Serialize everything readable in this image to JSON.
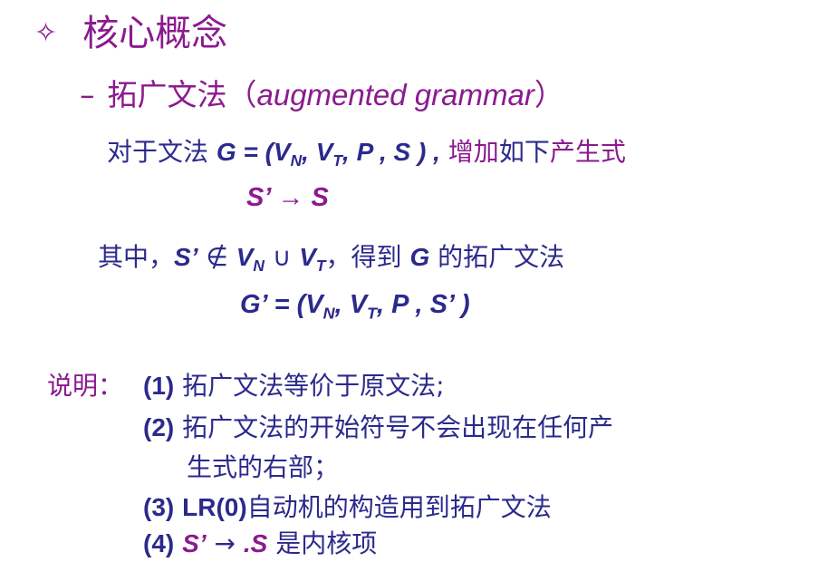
{
  "title": {
    "bullet": "✧",
    "text": "核心概念"
  },
  "subtitle": {
    "dash": "–",
    "zh": "拓广文法（",
    "en": "augmented grammar",
    "close": "）"
  },
  "intro": {
    "prefix": "对于文法",
    "g_def": "G = (V",
    "sub_n": "N",
    "comma1": ", V",
    "sub_t": "T",
    "rest": ", P , S ) ,",
    "highlight1": "增加",
    "mid": "如下",
    "highlight2": "产生式"
  },
  "production": {
    "text": "S’ → S"
  },
  "condition": {
    "prefix": "其中，",
    "s_prime": "S’",
    "notin": "∉",
    "v": "V",
    "sub_n": "N",
    "union": "∪",
    "v2": "V",
    "sub_t": "T",
    "suffix_a": "，得到 ",
    "g": "G",
    "suffix_b": " 的拓广文法"
  },
  "g_prime": {
    "head": "G’ = (V",
    "sub_n": "N",
    "comma": ", V",
    "sub_t": "T",
    "tail": ", P , S’ )"
  },
  "notes": {
    "label": "说明：",
    "items": [
      {
        "num": "(1)",
        "text": "拓广文法等价于原文法;"
      },
      {
        "num": "(2)",
        "text": "拓广文法的开始符号不会出现在任何产"
      },
      {
        "num": "",
        "text": "生式的右部；"
      },
      {
        "num": "(3)",
        "text_a": "LR(0)",
        "text": "自动机的构造用到拓广文法"
      },
      {
        "num": "(4)",
        "s_prime": "S’",
        "arrow": "→",
        "dot_s": ".S",
        "text": "是内核项"
      }
    ]
  },
  "colors": {
    "purple": "#8b1a8f",
    "navy": "#2b2a8c"
  }
}
